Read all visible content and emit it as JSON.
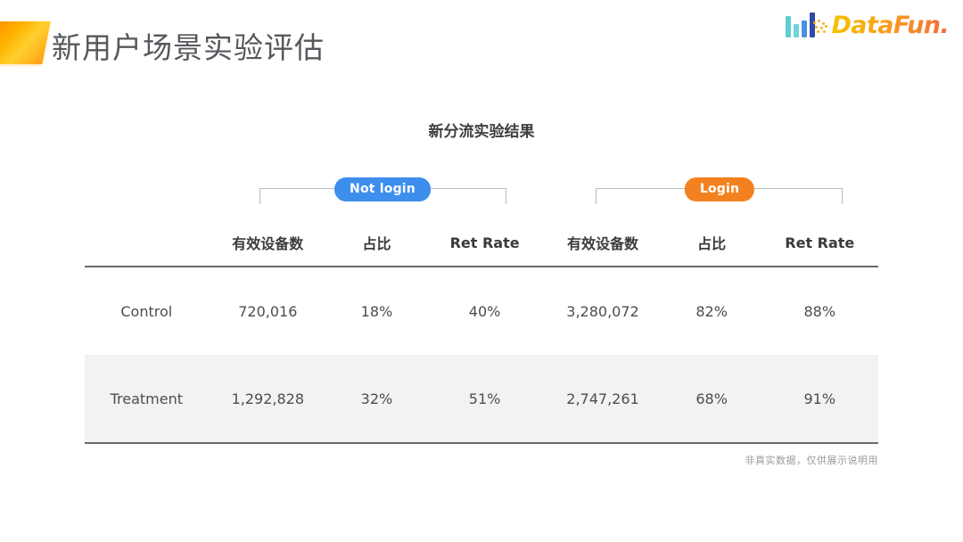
{
  "header": {
    "title": "新用户场景实验评估",
    "brand_name": "DataFun.",
    "brand_icon": "bar-chart-icon",
    "corner_icon": "orange-parallelogram-mark"
  },
  "chart_data": {
    "type": "table",
    "title": "新分流实验结果",
    "groups": [
      {
        "label": "Not login",
        "color": "#3e8eee",
        "span": 3
      },
      {
        "label": "Login",
        "color": "#f48120",
        "span": 3
      }
    ],
    "row_label_header": "",
    "columns": [
      "有效设备数",
      "占比",
      "Ret Rate",
      "有效设备数",
      "占比",
      "Ret Rate"
    ],
    "rows": [
      {
        "label": "Control",
        "values": [
          "720,016",
          "18%",
          "40%",
          "3,280,072",
          "82%",
          "88%"
        ]
      },
      {
        "label": "Treatment",
        "values": [
          "1,292,828",
          "32%",
          "51%",
          "2,747,261",
          "68%",
          "91%"
        ]
      }
    ],
    "footnote": "非真实数据，仅供展示说明用"
  }
}
